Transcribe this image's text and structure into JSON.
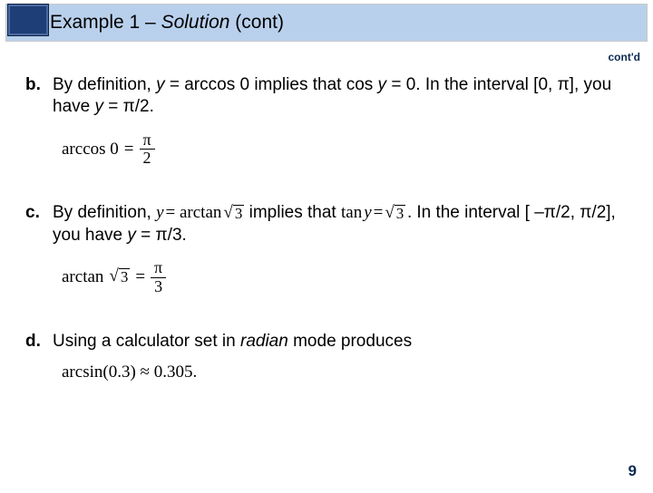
{
  "title": {
    "prefix": "Example 1 – ",
    "italic": "Solution",
    "suffix": " (cont)"
  },
  "cont_d": "cont'd",
  "items": {
    "b": {
      "label": "b.",
      "text1": " By definition, ",
      "var_y1": "y",
      "text2": " = arccos 0 implies that cos ",
      "var_y2": "y",
      "text3": " = 0. In the interval [0, π], you have ",
      "var_y3": "y",
      "text4": " = π/2.",
      "eq_lhs": "arccos 0",
      "eq_num": "π",
      "eq_den": "2"
    },
    "c": {
      "label": "c.",
      "text1": "By definition, ",
      "mid_pre_y": "y",
      "mid_eq1": " = arctan",
      "mid_sqrt": "3",
      "text2": " implies that ",
      "rhs_tan": "tan ",
      "rhs_y": "y",
      "rhs_eq": " = ",
      "rhs_sqrt": "3",
      "rhs_dot": ".",
      "after": "     In the interval [ –π/2, π/2], you have ",
      "var_y": "y",
      "after2": " = π/3.",
      "eq_lhs": "arctan",
      "eq_sqrt": "3",
      "eq_num": "π",
      "eq_den": "3"
    },
    "d": {
      "label": "d.",
      "text1": "Using a calculator set in ",
      "ital": "radian",
      "text2": " mode produces",
      "eq": "arcsin(0.3) ≈ 0.305."
    }
  },
  "page_number": "9"
}
